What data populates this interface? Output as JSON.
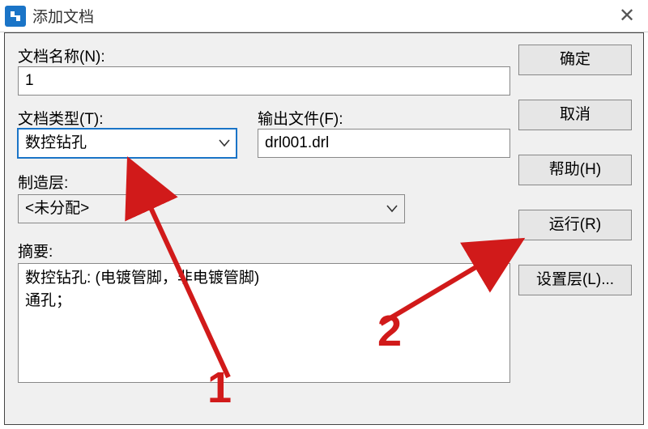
{
  "window": {
    "title": "添加文档"
  },
  "labels": {
    "doc_name": "文档名称(N):",
    "doc_type": "文档类型(T):",
    "output_file": "输出文件(F):",
    "mfg_layer": "制造层:",
    "summary": "摘要:"
  },
  "fields": {
    "doc_name_value": "1",
    "doc_type_value": "数控钻孔",
    "output_file_value": "drl001.drl",
    "mfg_layer_value": "<未分配>",
    "summary_value": "数控钻孔: (电镀管脚，非电镀管脚)\n通孔；"
  },
  "buttons": {
    "ok": "确定",
    "cancel": "取消",
    "help": "帮助(H)",
    "run": "运行(R)",
    "set_layer": "设置层(L)..."
  },
  "annotations": {
    "n1": "1",
    "n2": "2"
  }
}
